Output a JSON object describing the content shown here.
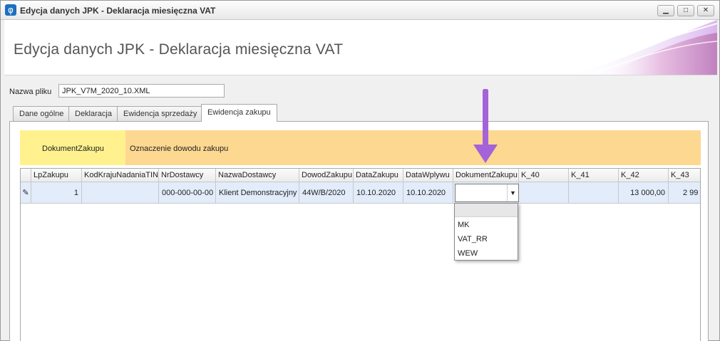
{
  "window": {
    "title": "Edycja danych JPK - Deklaracja miesięczna VAT",
    "icon": "phi-app-icon",
    "controls": [
      "minimize",
      "maximize",
      "close"
    ]
  },
  "header": {
    "title": "Edycja danych JPK - Deklaracja miesięczna VAT"
  },
  "file": {
    "label": "Nazwa pliku",
    "value": "JPK_V7M_2020_10.XML"
  },
  "tabs": [
    {
      "label": "Dane ogólne"
    },
    {
      "label": "Deklaracja"
    },
    {
      "label": "Ewidencja sprzedaży"
    },
    {
      "label": "Ewidencja zakupu"
    }
  ],
  "active_tab": "Ewidencja zakupu",
  "band": {
    "group_a": "DokumentZakupu",
    "group_b": "Oznaczenie dowodu zakupu"
  },
  "grid": {
    "columns": [
      "LpZakupu",
      "KodKrajuNadaniaTIN",
      "NrDostawcy",
      "NazwaDostawcy",
      "DowodZakupu",
      "DataZakupu",
      "DataWplywu",
      "DokumentZakupu",
      "K_40",
      "K_41",
      "K_42",
      "K_43"
    ],
    "row": {
      "LpZakupu": "1",
      "KodKrajuNadaniaTIN": "",
      "NrDostawcy": "000-000-00-00",
      "NazwaDostawcy": "Klient Demonstracyjny",
      "DowodZakupu": "44W/B/2020",
      "DataZakupu": "10.10.2020",
      "DataWplywu": "10.10.2020",
      "DokumentZakupu": "",
      "K_40": "",
      "K_41": "",
      "K_42": "13 000,00",
      "K_43": "2 99"
    }
  },
  "dropdown": {
    "options": [
      "",
      "MK",
      "VAT_RR",
      "WEW"
    ]
  },
  "colors": {
    "band_a": "#fff28e",
    "band_b": "#fdd891",
    "row_selected": "#e2ecfa",
    "arrow": "#a463d8"
  }
}
